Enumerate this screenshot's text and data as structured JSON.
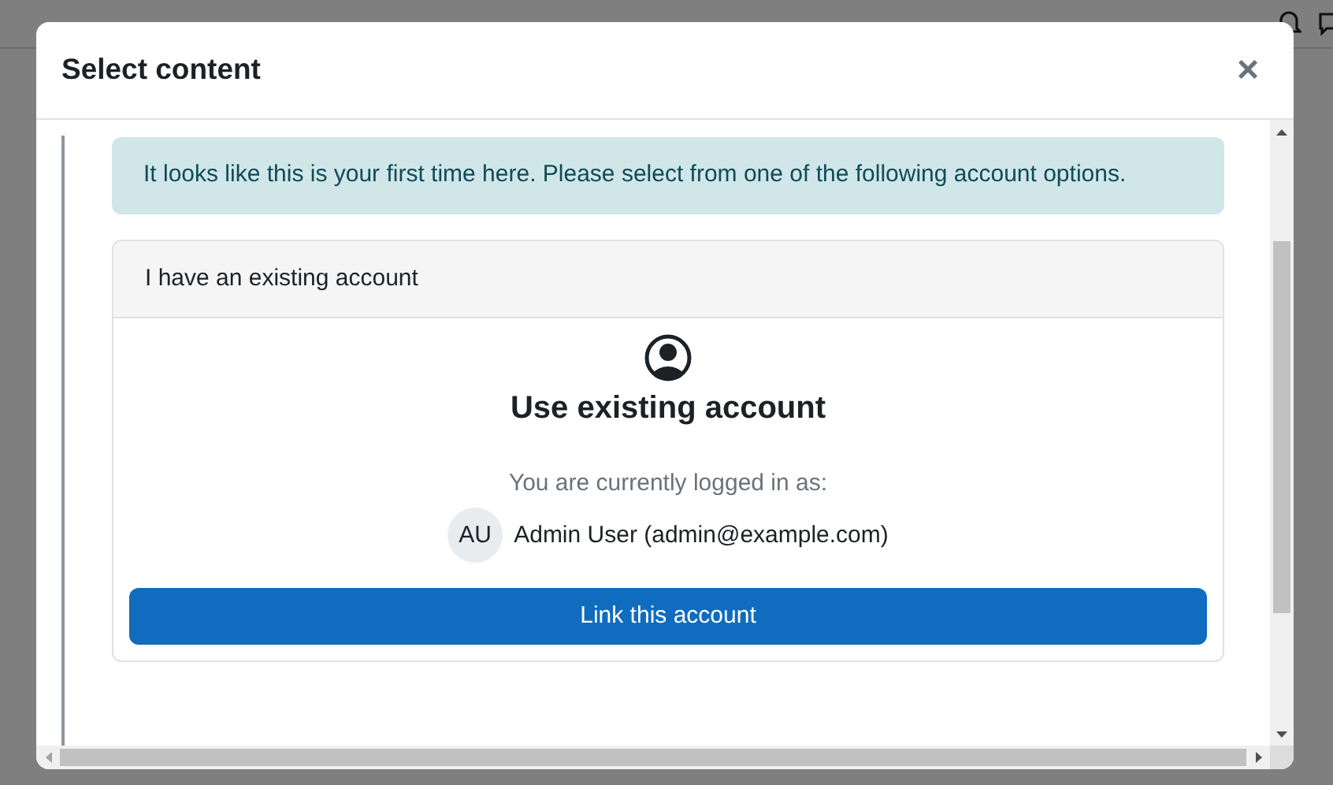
{
  "dialog": {
    "title": "Select content",
    "close_label": "×",
    "alert": "It looks like this is your first time here. Please select from one of the following account options.",
    "card": {
      "header": "I have an existing account",
      "title": "Use existing account",
      "logged_in_label": "You are currently logged in as:",
      "avatar_initials": "AU",
      "user": "Admin User (admin@example.com)",
      "button": "Link this account"
    }
  }
}
